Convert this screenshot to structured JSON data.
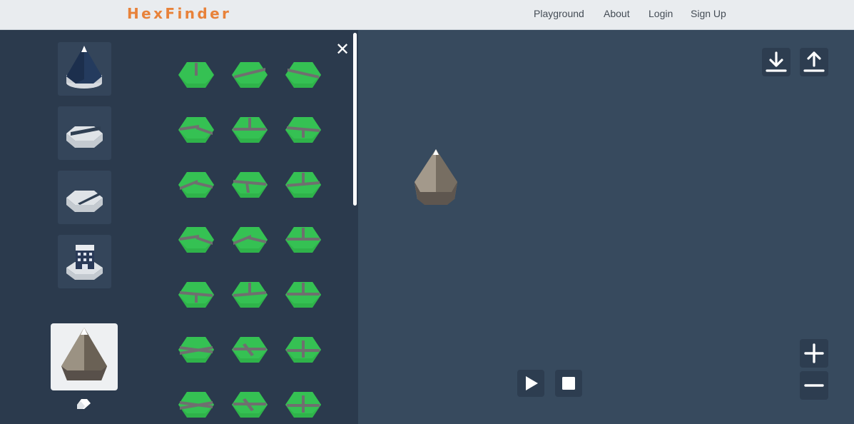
{
  "header": {
    "brand": "HexFinder",
    "nav": [
      {
        "label": "Playground"
      },
      {
        "label": "About"
      },
      {
        "label": "Login"
      },
      {
        "label": "Sign Up"
      }
    ]
  },
  "palette": {
    "categories": [
      {
        "icon": "mountain-icon"
      },
      {
        "icon": "road-straight-icon"
      },
      {
        "icon": "road-diagonal-icon"
      },
      {
        "icon": "building-icon"
      }
    ],
    "selected_tile_icon": "mountain-icon",
    "eraser_icon": "eraser-icon",
    "close_icon": "close-icon",
    "tiles": [
      "road-tile-straight",
      "road-tile-straight",
      "road-tile-straight",
      "road-tile-curve",
      "road-tile-junction",
      "road-tile-junction",
      "road-tile-curve",
      "road-tile-curve",
      "road-tile-junction",
      "road-tile-curve",
      "road-tile-curve",
      "road-tile-junction",
      "road-tile-junction",
      "road-tile-junction",
      "road-tile-junction",
      "road-tile-cross",
      "road-tile-cross",
      "road-tile-cross",
      "road-tile-cross",
      "road-tile-cross",
      "road-tile-cross"
    ]
  },
  "canvas": {
    "placed_tile_icon": "mountain-icon",
    "toolbar": {
      "download_icon": "download-icon",
      "upload_icon": "upload-icon",
      "play_icon": "play-icon",
      "stop_icon": "stop-icon",
      "zoom_in_icon": "plus-icon",
      "zoom_out_icon": "minus-icon"
    }
  },
  "colors": {
    "brand": "#e8823a",
    "topbar_bg": "#e9ecef",
    "panel_bg": "#2b3a4d",
    "canvas_bg": "#374a5e",
    "grass": "#2fb34a",
    "road": "#6f6f6f"
  }
}
